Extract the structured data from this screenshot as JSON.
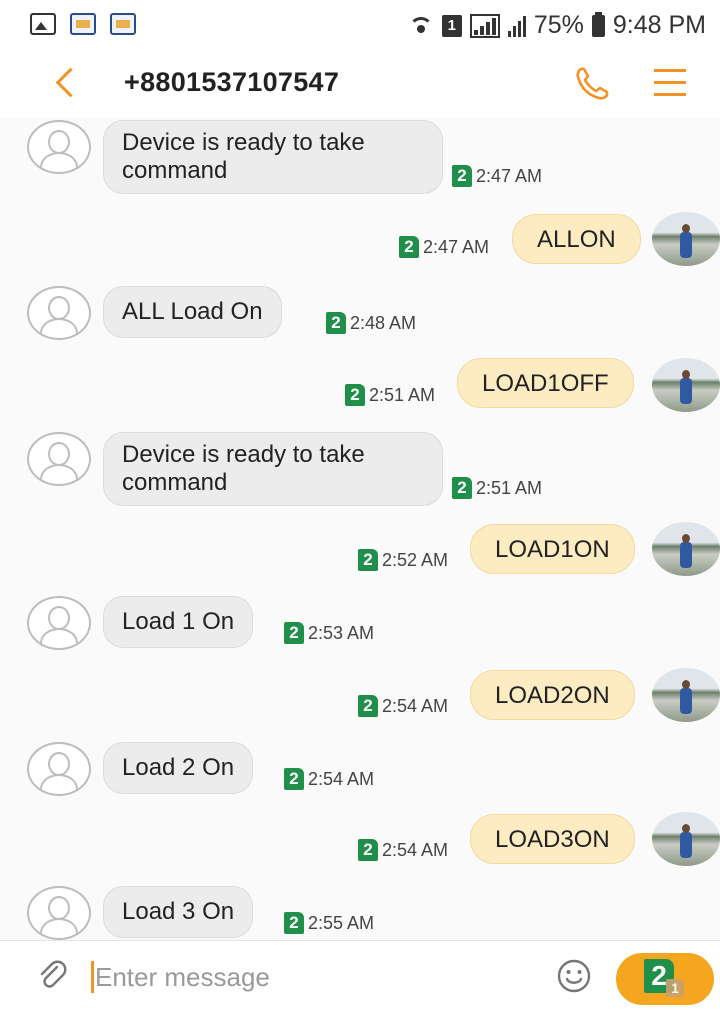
{
  "status_bar": {
    "battery": "75%",
    "time": "9:48 PM",
    "sim_label": "1"
  },
  "header": {
    "title": "+8801537107547"
  },
  "messages": [
    {
      "dir": "in",
      "text": "Device is ready to take command",
      "time": "2:47 AM",
      "sim": "2"
    },
    {
      "dir": "out",
      "text": "ALLON",
      "time": "2:47 AM",
      "sim": "2"
    },
    {
      "dir": "in",
      "text": "ALL Load  On",
      "time": "2:48 AM",
      "sim": "2"
    },
    {
      "dir": "out",
      "text": "LOAD1OFF",
      "time": "2:51 AM",
      "sim": "2"
    },
    {
      "dir": "in",
      "text": "Device is ready to take command",
      "time": "2:51 AM",
      "sim": "2"
    },
    {
      "dir": "out",
      "text": "LOAD1ON",
      "time": "2:52 AM",
      "sim": "2"
    },
    {
      "dir": "in",
      "text": "Load 1 On",
      "time": "2:53 AM",
      "sim": "2"
    },
    {
      "dir": "out",
      "text": "LOAD2ON",
      "time": "2:54 AM",
      "sim": "2"
    },
    {
      "dir": "in",
      "text": "Load 2 On",
      "time": "2:54 AM",
      "sim": "2"
    },
    {
      "dir": "out",
      "text": "LOAD3ON",
      "time": "2:54 AM",
      "sim": "2"
    },
    {
      "dir": "in",
      "text": "Load 3 On",
      "time": "2:55 AM",
      "sim": "2"
    }
  ],
  "composer": {
    "placeholder": "Enter message",
    "send_sim": "2",
    "send_sim_small": "1"
  },
  "colors": {
    "accent": "#f29227",
    "send_button": "#f4a61e",
    "sim_badge": "#1f8f4a",
    "bubble_in": "#ececec",
    "bubble_out": "#fdecc2"
  }
}
